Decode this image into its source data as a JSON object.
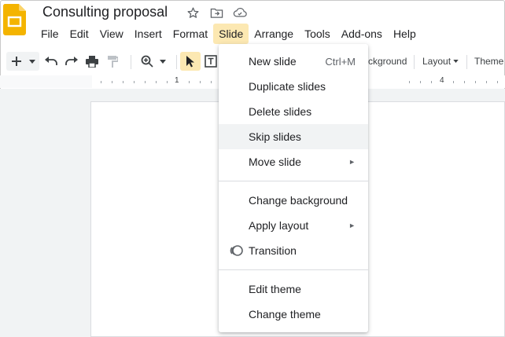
{
  "doc": {
    "title": "Consulting proposal"
  },
  "menubar": [
    "File",
    "Edit",
    "View",
    "Insert",
    "Format",
    "Slide",
    "Arrange",
    "Tools",
    "Add-ons",
    "Help"
  ],
  "toolbar": {
    "background_label": "ckground",
    "layout_label": "Layout",
    "theme_label": "Theme"
  },
  "ruler": {
    "marks": [
      "1",
      "4"
    ]
  },
  "slide_menu": {
    "items": [
      {
        "label": "New slide",
        "shortcut": "Ctrl+M"
      },
      {
        "label": "Duplicate slides"
      },
      {
        "label": "Delete slides"
      },
      {
        "label": "Skip slides"
      },
      {
        "label": "Move slide"
      },
      {
        "label": "Change background"
      },
      {
        "label": "Apply layout"
      },
      {
        "label": "Transition"
      },
      {
        "label": "Edit theme"
      },
      {
        "label": "Change theme"
      }
    ]
  },
  "colors": {
    "slides_brand": "#f4b400",
    "active_highlight": "#fce8b2",
    "hover_bg": "#f1f3f4"
  }
}
